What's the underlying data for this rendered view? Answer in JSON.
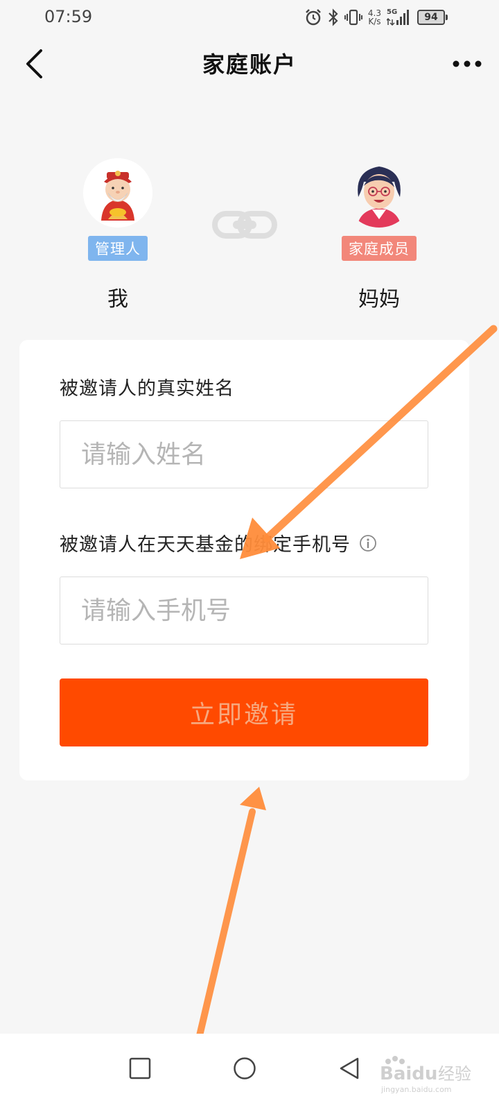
{
  "status_bar": {
    "time": "07:59",
    "net_speed_value": "4.3",
    "net_speed_unit": "K/s",
    "signal_label": "5G",
    "battery": "94"
  },
  "nav": {
    "title": "家庭账户"
  },
  "members": [
    {
      "role": "管理人",
      "name": "我",
      "badge_color": "#7fb5ee"
    },
    {
      "role": "家庭成员",
      "name": "妈妈",
      "badge_color": "#f2877a"
    }
  ],
  "form": {
    "name_label": "被邀请人的真实姓名",
    "name_placeholder": "请输入姓名",
    "phone_label": "被邀请人在天天基金的绑定手机号",
    "phone_placeholder": "请输入手机号",
    "submit_label": "立即邀请"
  },
  "colors": {
    "accent": "#ff4a00",
    "annotation": "#ff8c3a"
  },
  "watermark": {
    "brand": "Baidu",
    "suffix": "经验",
    "site": "jingyan.baidu.com"
  }
}
